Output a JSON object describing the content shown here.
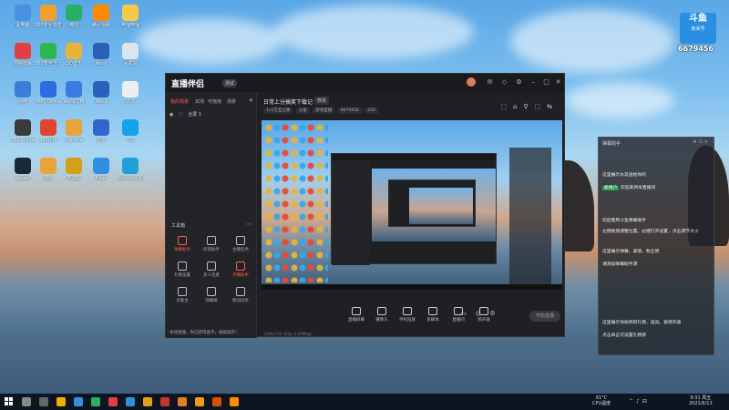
{
  "desktop": {
    "icons": [
      {
        "label": "此电脑",
        "color": "#4a90e2"
      },
      {
        "label": "360安全浏览器",
        "color": "#f0a030"
      },
      {
        "label": "微信",
        "color": "#2aae67"
      },
      {
        "label": "腾讯视频",
        "color": "#ff8a00"
      },
      {
        "label": "哔哩哔哩",
        "color": "#f6c94a"
      },
      {
        "label": "控制面板",
        "color": "#e04040"
      },
      {
        "label": "360安全卫士",
        "color": "#2db84d"
      },
      {
        "label": "QQ音乐",
        "color": "#e8b33a"
      },
      {
        "label": "Word",
        "color": "#2b5fb8"
      },
      {
        "label": "回收站",
        "color": "#dde4ea"
      },
      {
        "label": "网络",
        "color": "#3a7fd5"
      },
      {
        "label": "WPS Office",
        "color": "#2c6be0"
      },
      {
        "label": "Word文档",
        "color": "#3b7be0"
      },
      {
        "label": "Word",
        "color": "#2b5fb8"
      },
      {
        "label": "文件",
        "color": "#eeeeee"
      },
      {
        "label": "OBS Studio",
        "color": "#3a3a3a"
      },
      {
        "label": "360压缩",
        "color": "#e0452e"
      },
      {
        "label": "Chrome",
        "color": "#e8a33a"
      },
      {
        "label": "迅雷",
        "color": "#3366cc"
      },
      {
        "label": "QQ",
        "color": "#16a2e8"
      },
      {
        "label": "Steam",
        "color": "#1b2838"
      },
      {
        "label": "游戏",
        "color": "#e8a33a"
      },
      {
        "label": "PUBG",
        "color": "#d4a017"
      },
      {
        "label": "Edge",
        "color": "#2f8fe0"
      },
      {
        "label": "Microsoft Edge",
        "color": "#1fa1d8"
      }
    ]
  },
  "app": {
    "logo": "直播伴侣",
    "version": "测试",
    "tabs": [
      "我的场景",
      "双场",
      "可拖拽",
      "场景"
    ],
    "scene_item": "全屏 1",
    "tools_label": "工具箱",
    "tools": [
      {
        "label": "弹幕助手",
        "red": true
      },
      {
        "label": "房管助手",
        "red": false
      },
      {
        "label": "主播任务",
        "red": false
      },
      {
        "label": "礼物设置",
        "red": false
      },
      {
        "label": "多人连麦",
        "red": false
      },
      {
        "label": "点播助手",
        "red": true
      },
      {
        "label": "点歌台",
        "red": false
      },
      {
        "label": "弹幕姬",
        "red": false
      },
      {
        "label": "歌词同步",
        "red": false
      }
    ],
    "bottom_text": "本场直播，你已获得金币，再接再厉！",
    "room_title": "日常上分搞笑下载记",
    "room_edit": "修改",
    "room_meta": [
      "1v1交互之路",
      "斗鱼",
      "游戏直播",
      "6679456",
      "259"
    ],
    "controls": [
      {
        "label": "直播屏幕"
      },
      {
        "label": "摄像头"
      },
      {
        "label": "手机投屏"
      },
      {
        "label": "多媒体"
      },
      {
        "label": "直播间"
      },
      {
        "label": "扬声器"
      }
    ],
    "start_button": "开始直播",
    "status": "1280x720 30fps 0.00Mbps"
  },
  "danmu": {
    "title": "弹幕助手",
    "messages": [
      {
        "text": "这里展示水友送给你的"
      },
      {
        "tag": "新用户",
        "text": "欢迎来到本直播间"
      },
      {
        "text": "欢迎使用斗鱼弹幕助手"
      },
      {
        "text": "左键拖拽调整位置，右键打开设置，点击调节大小"
      },
      {
        "text": "这里展示弹幕、表情、粉丝牌"
      },
      {
        "text": "请添加弹幕助手源"
      },
      {
        "text": "这里展示你收到的礼物、道具、表情开通"
      },
      {
        "text": "点击单击可设置礼物源"
      }
    ]
  },
  "logo": {
    "mark": "斗鱼",
    "sub": "房间号",
    "room_number": "6679456"
  },
  "taskbar": {
    "weather_temp": "61°C",
    "weather_label": "CPU温度",
    "time": "9:31 周五",
    "date": "2021/6/13"
  }
}
